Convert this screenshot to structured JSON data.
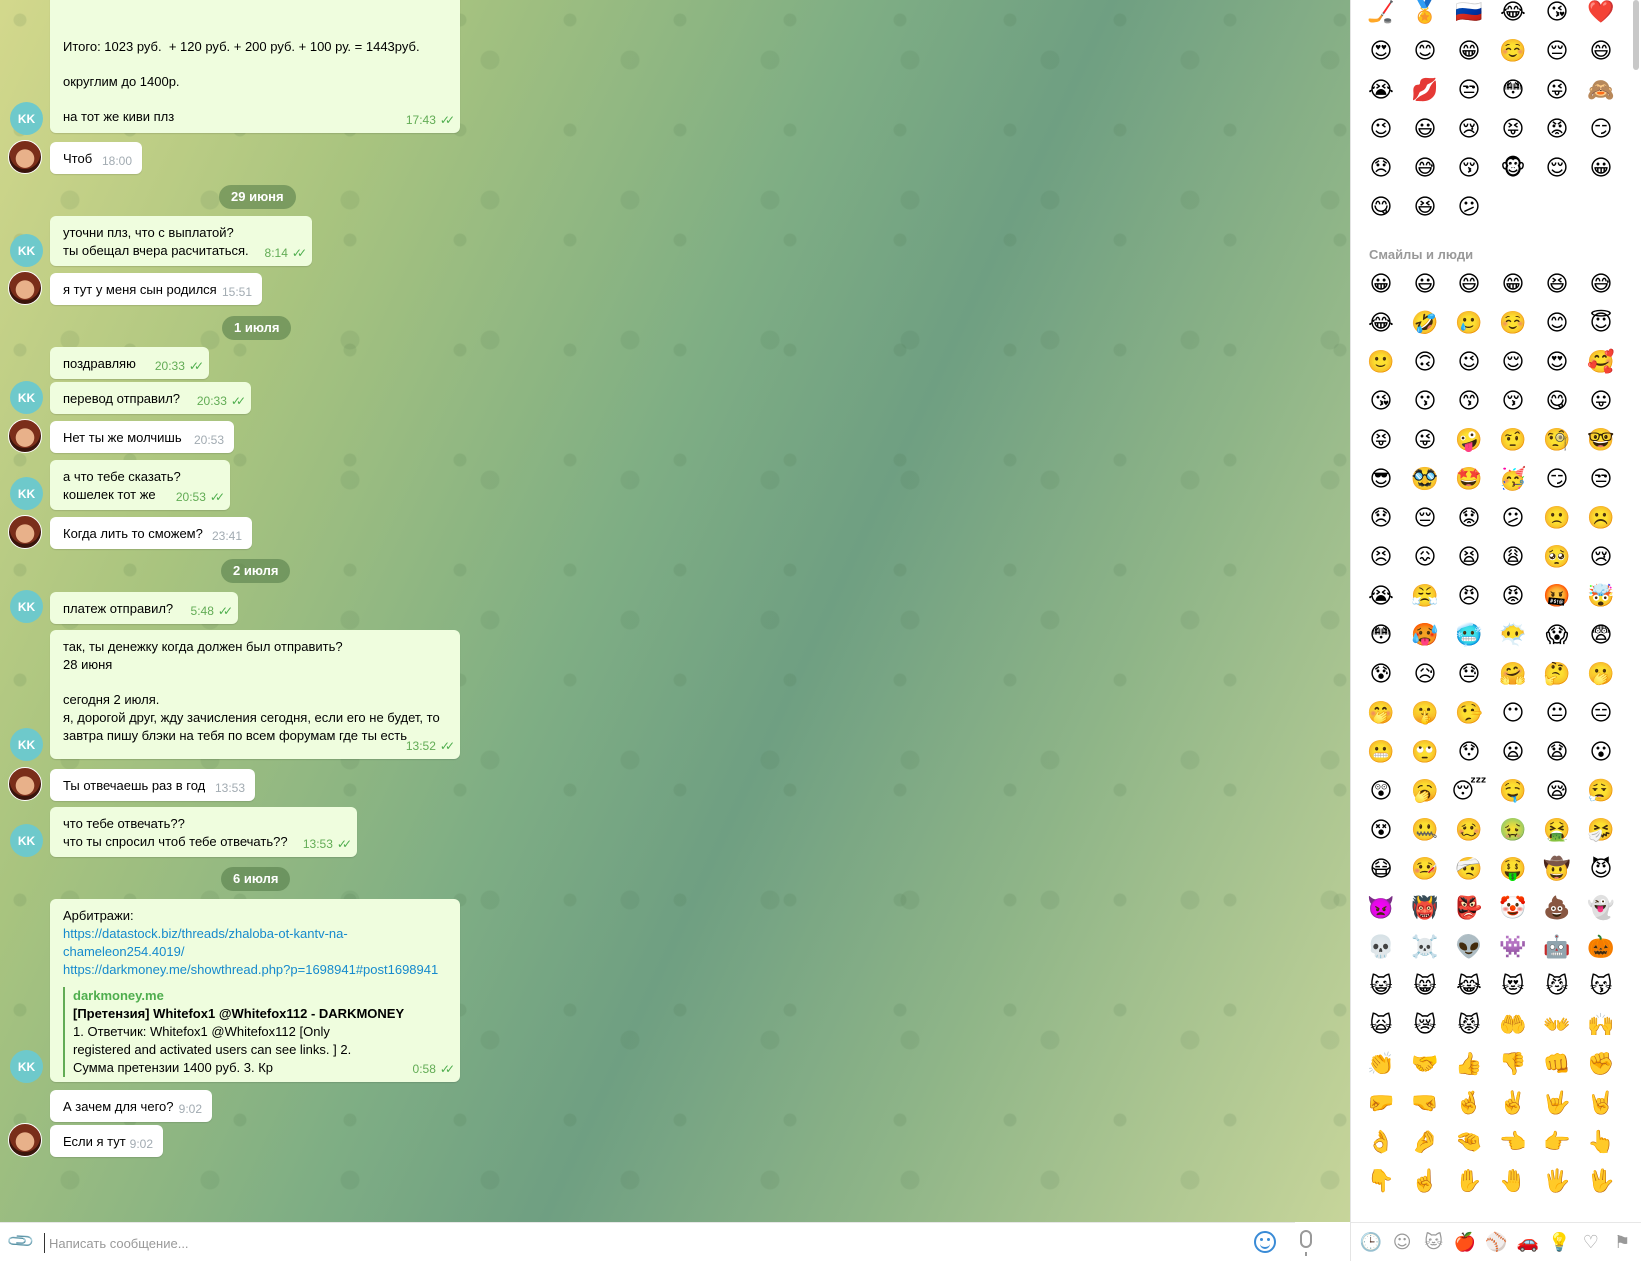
{
  "messages": [
    {
      "id": 1,
      "dir": "out",
      "lines": [
        "Итого: 1023 руб.  + 120 руб. + 200 руб. + 100 ру. = 1443руб.",
        "",
        "округлим до 1400р.",
        "",
        "на тот же киви плз"
      ],
      "time": "17:43",
      "read": true
    },
    {
      "id": 2,
      "dir": "in",
      "text": "Чтоб",
      "time": "18:00"
    },
    {
      "id": 3,
      "dir": "out",
      "lines": [
        "уточни плз, что с выплатой?",
        "ты обещал вчера расчитаться."
      ],
      "time": "8:14",
      "read": true
    },
    {
      "id": 4,
      "dir": "in",
      "text": "я тут у меня сын родился",
      "time": "15:51"
    },
    {
      "id": 5,
      "dir": "out",
      "text": "поздравляю",
      "time": "20:33",
      "read": true
    },
    {
      "id": 6,
      "dir": "out",
      "text": "перевод отправил?",
      "time": "20:33",
      "read": true
    },
    {
      "id": 7,
      "dir": "in",
      "text": "Нет ты же молчишь",
      "time": "20:53"
    },
    {
      "id": 8,
      "dir": "out",
      "lines": [
        "а что тебе сказать?",
        "кошелек тот же"
      ],
      "time": "20:53",
      "read": true
    },
    {
      "id": 9,
      "dir": "in",
      "text": "Когда лить то сможем?",
      "time": "23:41"
    },
    {
      "id": 10,
      "dir": "out",
      "text": "платеж отправил?",
      "time": "5:48",
      "read": true
    },
    {
      "id": 11,
      "dir": "out",
      "lines": [
        "так, ты денежку когда должен был отправить?",
        "28 июня",
        "",
        "сегодня 2 июля.",
        "я, дорогой друг, жду зачисления сегодня, если его не будет, то",
        "завтра пишу блэки на тебя по всем форумам где ты есть"
      ],
      "time": "13:52",
      "read": true
    },
    {
      "id": 12,
      "dir": "in",
      "text": "Ты отвечаешь раз в год",
      "time": "13:53"
    },
    {
      "id": 13,
      "dir": "out",
      "lines": [
        "что тебе отвечать??",
        "что ты спросил чтоб тебе отвечать??"
      ],
      "time": "13:53",
      "read": true
    },
    {
      "id": 14,
      "dir": "out",
      "label": "Арбитражи:",
      "link1_a": "https://datastock.biz/threads/zhaloba-ot-kantv-na-",
      "link1_b": "chameleon254.4019/",
      "link2": "https://darkmoney.me/showthread.php?p=1698941#post1698941",
      "preview_site": "darkmoney.me",
      "preview_title": "[Претензия] Whitefox1 @Whitefox112 - DARKMONEY",
      "preview_text": "1. Ответчик: Whitefox1 @Whitefox112 [Only registered and activated users can see links. ] 2. Сумма претензии 1400 руб. 3. Кр",
      "time": "0:58",
      "read": true
    },
    {
      "id": 15,
      "dir": "in",
      "text": "А зачем для чего?",
      "time": "9:02"
    },
    {
      "id": 16,
      "dir": "in",
      "text": "Если я тут",
      "time": "9:02"
    }
  ],
  "dates": {
    "d1": "29 июня",
    "d2": "1 июля",
    "d3": "2 июля",
    "d4": "6 июля"
  },
  "avatar_initials": "KK",
  "input": {
    "placeholder": "Написать сообщение..."
  },
  "emoji_panel": {
    "recent": [
      "🏒",
      "🏅",
      "🇷🇺",
      "😂",
      "😘",
      "❤️",
      "😍",
      "😊",
      "😁",
      "☺️",
      "😔",
      "😄",
      "😭",
      "💋",
      "😒",
      "😳",
      "😜",
      "🙈",
      "😉",
      "😃",
      "😢",
      "😝",
      "😡",
      "😏",
      "😞",
      "😅",
      "😚",
      "🐵",
      "😌",
      "😀",
      "😋",
      "😆",
      "😕"
    ],
    "section_title": "Смайлы и люди",
    "people": [
      "😀",
      "😃",
      "😄",
      "😁",
      "😆",
      "😅",
      "😂",
      "🤣",
      "🥲",
      "☺️",
      "😊",
      "😇",
      "🙂",
      "🙃",
      "😉",
      "😌",
      "😍",
      "🥰",
      "😘",
      "😗",
      "😙",
      "😚",
      "😋",
      "😛",
      "😝",
      "😜",
      "🤪",
      "🤨",
      "🧐",
      "🤓",
      "😎",
      "🥸",
      "🤩",
      "🥳",
      "😏",
      "😒",
      "😞",
      "😔",
      "😟",
      "😕",
      "🙁",
      "☹️",
      "😣",
      "😖",
      "😫",
      "😩",
      "🥺",
      "😢",
      "😭",
      "😤",
      "😠",
      "😡",
      "🤬",
      "🤯",
      "😳",
      "🥵",
      "🥶",
      "😶‍🌫️",
      "😱",
      "😨",
      "😰",
      "😥",
      "😓",
      "🤗",
      "🤔",
      "🫢",
      "🤭",
      "🤫",
      "🤥",
      "😶",
      "😐",
      "😑",
      "😬",
      "🙄",
      "😯",
      "😦",
      "😧",
      "😮",
      "😲",
      "🥱",
      "😴",
      "🤤",
      "😪",
      "😮‍💨",
      "😵",
      "🤐",
      "🥴",
      "🤢",
      "🤮",
      "🤧",
      "😷",
      "🤒",
      "🤕",
      "🤑",
      "🤠",
      "😈",
      "👿",
      "👹",
      "👺",
      "🤡",
      "💩",
      "👻",
      "💀",
      "☠️",
      "👽",
      "👾",
      "🤖",
      "🎃",
      "😺",
      "😸",
      "😹",
      "😻",
      "😼",
      "😽",
      "🙀",
      "😿",
      "😾",
      "🤲",
      "👐",
      "🙌",
      "👏",
      "🤝",
      "👍",
      "👎",
      "👊",
      "✊",
      "🤛",
      "🤜",
      "🤞",
      "✌️",
      "🤟",
      "🤘",
      "👌",
      "🤌",
      "🤏",
      "👈",
      "👉",
      "👆",
      "👇",
      "☝️",
      "✋",
      "🤚",
      "🖐️",
      "🖖"
    ],
    "tabs": [
      {
        "name": "recent",
        "glyph": "🕒"
      },
      {
        "name": "people",
        "glyph": "☺"
      },
      {
        "name": "animals",
        "glyph": "🐱"
      },
      {
        "name": "food",
        "glyph": "🍎"
      },
      {
        "name": "activity",
        "glyph": "⚾"
      },
      {
        "name": "travel",
        "glyph": "🚗"
      },
      {
        "name": "objects",
        "glyph": "💡"
      },
      {
        "name": "symbols",
        "glyph": "♡"
      },
      {
        "name": "flags",
        "glyph": "⚑"
      }
    ]
  }
}
